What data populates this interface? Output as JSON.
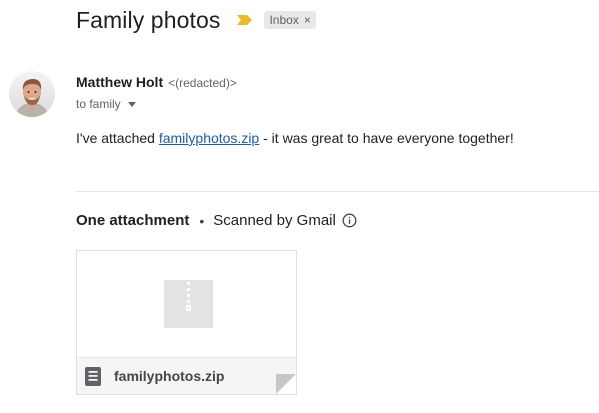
{
  "header": {
    "subject": "Family photos",
    "importance_icon": "importance-marker-icon",
    "label": "Inbox",
    "label_close": "×"
  },
  "message": {
    "sender_name": "Matthew Holt",
    "sender_email": "<(redacted)>",
    "to_line": "to family",
    "body_before_link": "I've attached ",
    "link_text": "familyphotos.zip",
    "body_after_link": " - it was great to have everyone together!"
  },
  "attachments": {
    "title": "One attachment",
    "separator": "•",
    "scanned_label": "Scanned by Gmail",
    "items": [
      {
        "file_name": "familyphotos.zip",
        "file_icon": "archive-file-icon"
      }
    ]
  },
  "colors": {
    "importance": "#f2b824",
    "link": "#1a57c9",
    "chip_background": "#e8e8e8"
  }
}
